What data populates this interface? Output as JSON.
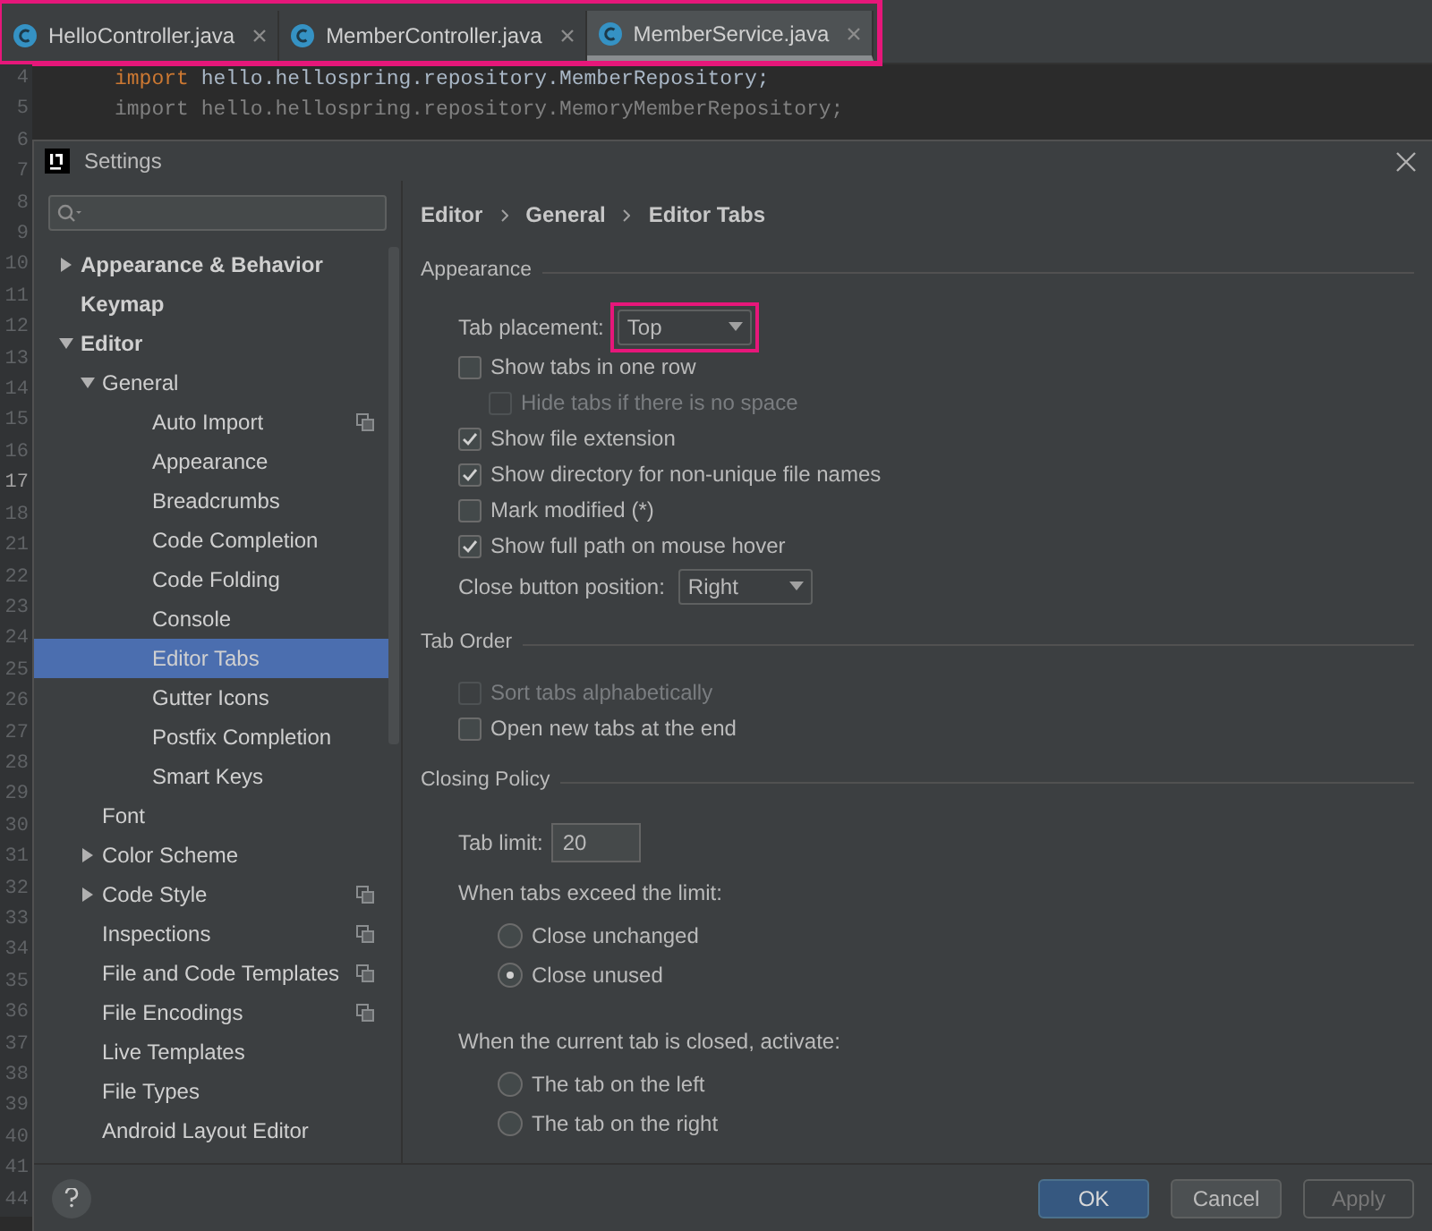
{
  "editor_tabs": [
    {
      "label": "HelloController.java",
      "selected": false
    },
    {
      "label": "MemberController.java",
      "selected": false
    },
    {
      "label": "MemberService.java",
      "selected": true
    }
  ],
  "editor_tabs_highlighted": true,
  "line_numbers": [
    {
      "number": "4",
      "current": false
    },
    {
      "number": "5",
      "current": false
    },
    {
      "number": "6",
      "current": false
    },
    {
      "number": "7",
      "current": false
    },
    {
      "number": "8",
      "current": false
    },
    {
      "number": "9",
      "current": false
    },
    {
      "number": "10",
      "current": false
    },
    {
      "number": "11",
      "current": false
    },
    {
      "number": "12",
      "current": false
    },
    {
      "number": "13",
      "current": false
    },
    {
      "number": "14",
      "current": false
    },
    {
      "number": "15",
      "current": false
    },
    {
      "number": "16",
      "current": false
    },
    {
      "number": "17",
      "current": true
    },
    {
      "number": "18",
      "current": false
    },
    {
      "number": "21",
      "current": false
    },
    {
      "number": "22",
      "current": false
    },
    {
      "number": "23",
      "current": false
    },
    {
      "number": "24",
      "current": false
    },
    {
      "number": "25",
      "current": false
    },
    {
      "number": "26",
      "current": false
    },
    {
      "number": "27",
      "current": false
    },
    {
      "number": "28",
      "current": false
    },
    {
      "number": "29",
      "current": false
    },
    {
      "number": "30",
      "current": false
    },
    {
      "number": "31",
      "current": false
    },
    {
      "number": "32",
      "current": false
    },
    {
      "number": "33",
      "current": false
    },
    {
      "number": "34",
      "current": false
    },
    {
      "number": "35",
      "current": false
    },
    {
      "number": "36",
      "current": false
    },
    {
      "number": "37",
      "current": false
    },
    {
      "number": "38",
      "current": false
    },
    {
      "number": "39",
      "current": false
    },
    {
      "number": "40",
      "current": false
    },
    {
      "number": "41",
      "current": false
    },
    {
      "number": "44",
      "current": false
    }
  ],
  "code_lines": [
    {
      "keyword": "import",
      "text": "hello.hellospring.repository.MemberRepository;",
      "unused": false
    },
    {
      "keyword": "import",
      "text": "hello.hellospring.repository.MemoryMemberRepository;",
      "unused": true
    }
  ],
  "dialog": {
    "title": "Settings"
  },
  "sidebar": {
    "items": [
      {
        "label": "Appearance & Behavior",
        "expanded": false
      },
      {
        "label": "Keymap"
      },
      {
        "label": "Editor",
        "expanded": true,
        "children": [
          {
            "label": "General",
            "expanded": true,
            "children": [
              {
                "label": "Auto Import",
                "selected": false,
                "shared": true
              },
              {
                "label": "Appearance",
                "selected": false,
                "shared": false
              },
              {
                "label": "Breadcrumbs",
                "selected": false,
                "shared": false
              },
              {
                "label": "Code Completion",
                "selected": false,
                "shared": false
              },
              {
                "label": "Code Folding",
                "selected": false,
                "shared": false
              },
              {
                "label": "Console",
                "selected": false,
                "shared": false
              },
              {
                "label": "Editor Tabs",
                "selected": true,
                "shared": false
              },
              {
                "label": "Gutter Icons",
                "selected": false,
                "shared": false
              },
              {
                "label": "Postfix Completion",
                "selected": false,
                "shared": false
              },
              {
                "label": "Smart Keys",
                "selected": false,
                "shared": false
              }
            ]
          },
          {
            "label": "Font",
            "shared": false
          },
          {
            "label": "Color Scheme",
            "expanded": false,
            "shared": false
          },
          {
            "label": "Code Style",
            "expanded": false,
            "shared": true
          },
          {
            "label": "Inspections",
            "shared": true
          },
          {
            "label": "File and Code Templates",
            "shared": true
          },
          {
            "label": "File Encodings",
            "shared": true
          },
          {
            "label": "Live Templates",
            "shared": false
          },
          {
            "label": "File Types",
            "shared": false
          },
          {
            "label": "Android Layout Editor",
            "shared": false
          }
        ]
      }
    ]
  },
  "breadcrumb": [
    "Editor",
    "General",
    "Editor Tabs"
  ],
  "sections": [
    {
      "title": "Appearance",
      "items": [
        {
          "kind": "dropdown",
          "label": "Tab placement:",
          "value": "Top",
          "highlighted": true
        },
        {
          "kind": "checkbox",
          "label": "Show tabs in one row",
          "checked": false,
          "disabled": false,
          "children": [
            {
              "kind": "checkbox",
              "label": "Hide tabs if there is no space",
              "checked": false,
              "disabled": true
            }
          ]
        },
        {
          "kind": "checkbox",
          "label": "Show file extension",
          "checked": true,
          "disabled": false
        },
        {
          "kind": "checkbox",
          "label": "Show directory for non-unique file names",
          "checked": true,
          "disabled": false
        },
        {
          "kind": "checkbox",
          "label": "Mark modified (*)",
          "checked": false,
          "disabled": false
        },
        {
          "kind": "checkbox",
          "label": "Show full path on mouse hover",
          "checked": true,
          "disabled": false
        },
        {
          "kind": "dropdown",
          "label": "Close button position:",
          "value": "Right",
          "highlighted": false
        }
      ]
    },
    {
      "title": "Tab Order",
      "items": [
        {
          "kind": "checkbox",
          "label": "Sort tabs alphabetically",
          "checked": false,
          "disabled": true
        },
        {
          "kind": "checkbox",
          "label": "Open new tabs at the end",
          "checked": false,
          "disabled": false
        }
      ]
    },
    {
      "title": "Closing Policy",
      "items": [
        {
          "kind": "number",
          "label": "Tab limit:",
          "value": "20"
        },
        {
          "kind": "label",
          "label": "When tabs exceed the limit:",
          "children": [
            {
              "kind": "radio",
              "label": "Close unchanged",
              "selected": false
            },
            {
              "kind": "radio",
              "label": "Close unused",
              "selected": true
            }
          ]
        },
        {
          "kind": "label",
          "label": "When the current tab is closed, activate:",
          "children": [
            {
              "kind": "radio",
              "label": "The tab on the left",
              "selected": false
            },
            {
              "kind": "radio",
              "label": "The tab on the right",
              "selected": false
            }
          ]
        }
      ]
    }
  ],
  "buttons": [
    {
      "label": "OK",
      "kind": "default",
      "disabled": false
    },
    {
      "label": "Cancel",
      "kind": "normal",
      "disabled": false
    },
    {
      "label": "Apply",
      "kind": "normal",
      "disabled": true
    }
  ]
}
